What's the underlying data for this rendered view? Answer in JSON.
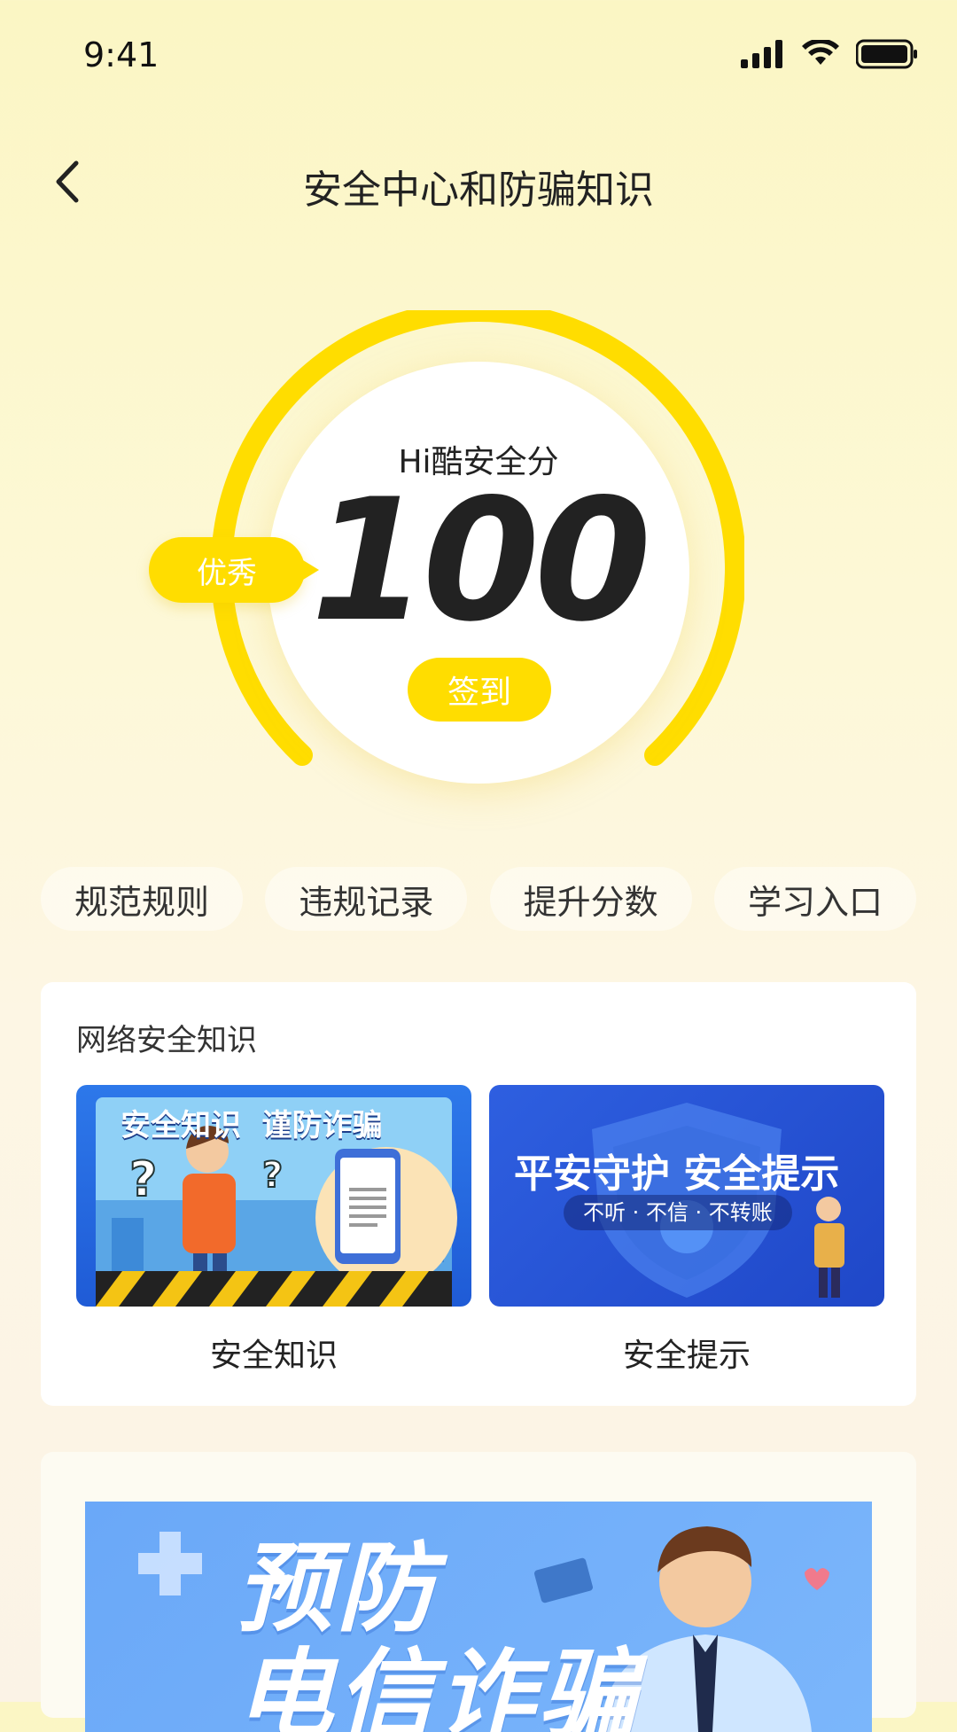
{
  "status_bar": {
    "time": "9:41",
    "signal_icon": "signal-icon",
    "wifi_icon": "wifi-icon",
    "battery_icon": "battery-icon"
  },
  "header": {
    "title": "安全中心和防骗知识",
    "back_icon": "chevron-left-icon"
  },
  "score": {
    "label": "Hi酷安全分",
    "value": "100",
    "rating": "优秀",
    "checkin_label": "签到",
    "gauge_fill": 1.0
  },
  "quick_links": [
    {
      "label": "规范规则"
    },
    {
      "label": "违规记录"
    },
    {
      "label": "提升分数"
    },
    {
      "label": "学习入口"
    }
  ],
  "knowledge_card": {
    "title": "网络安全知识",
    "tiles": [
      {
        "banner_text": "安全知识  谨防诈骗",
        "caption": "安全知识"
      },
      {
        "banner_text": "平安守护 安全提示",
        "banner_subtext": "不听 · 不信 · 不转账",
        "caption": "安全提示"
      }
    ]
  },
  "bottom_banner": {
    "line1": "预防",
    "line2": "电信诈骗"
  },
  "colors": {
    "accent": "#FFDD00",
    "tile_blue": "#2E5FE0"
  }
}
